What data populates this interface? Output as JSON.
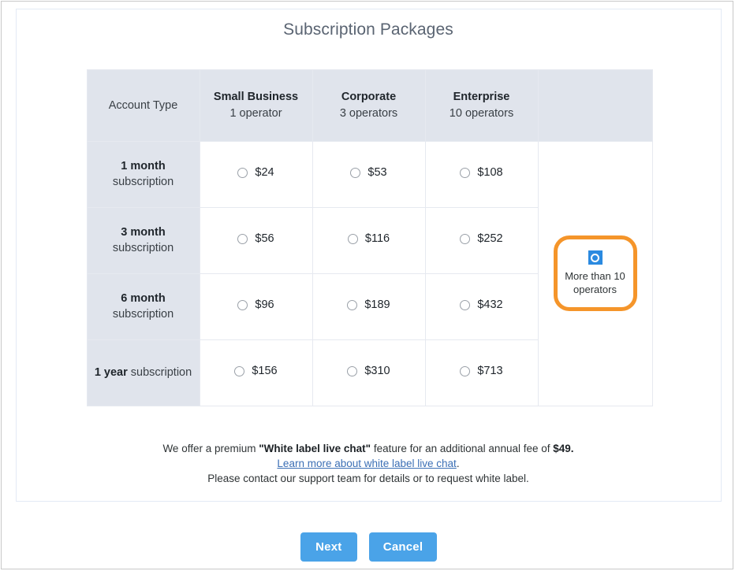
{
  "panel": {
    "title": "Subscription Packages"
  },
  "table": {
    "headers": [
      {
        "label": "Account Type",
        "operators": ""
      },
      {
        "label": "Small Business",
        "operators": "1 operator"
      },
      {
        "label": "Corporate",
        "operators": "3 operators"
      },
      {
        "label": "Enterprise",
        "operators": "10 operators"
      },
      {
        "label": "",
        "operators": ""
      }
    ],
    "rows": [
      {
        "label_strong": "1 month",
        "label_rest": "subscription",
        "layout": "two-line",
        "prices": [
          "$24",
          "$53",
          "$108"
        ]
      },
      {
        "label_strong": "3 month",
        "label_rest": "subscription",
        "layout": "two-line",
        "prices": [
          "$56",
          "$116",
          "$252"
        ]
      },
      {
        "label_strong": "6 month",
        "label_rest": "subscription",
        "layout": "two-line",
        "prices": [
          "$96",
          "$189",
          "$432"
        ]
      },
      {
        "label_strong": "1 year",
        "label_rest": " subscription",
        "layout": "one-line",
        "prices": [
          "$156",
          "$310",
          "$713"
        ]
      }
    ],
    "more_option": {
      "icon": "selected-radio-icon",
      "text": "More than 10 operators",
      "border_color": "#f5952a",
      "icon_color": "#2b8ae0"
    }
  },
  "note": {
    "line1_pre": "We offer a premium ",
    "line1_bold": "\"White label live chat\"",
    "line1_mid": " feature for an additional annual fee of ",
    "line1_price": "$49",
    "line1_end": ".",
    "link_text": "Learn more about white label live chat",
    "link_suffix": ".",
    "line3": "Please contact our support team for details or to request white label."
  },
  "buttons": {
    "next_label": "Next",
    "cancel_label": "Cancel",
    "color": "#4aa3e8"
  }
}
